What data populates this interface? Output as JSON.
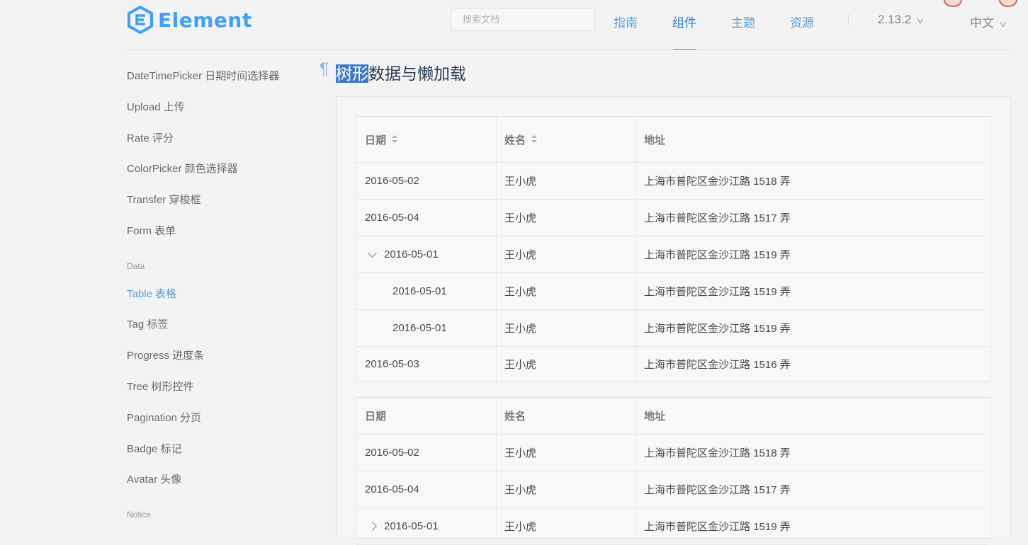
{
  "header": {
    "logo_text": "Element",
    "search_placeholder": "搜索文档",
    "nav": [
      "指南",
      "组件",
      "主题",
      "资源"
    ],
    "active_nav": "组件",
    "version": "2.13.2",
    "language": "中文"
  },
  "sidebar": {
    "items_top": [
      "DateTimePicker 日期时间选择器",
      "Upload 上传",
      "Rate 评分",
      "ColorPicker 颜色选择器",
      "Transfer 穿梭框",
      "Form 表单"
    ],
    "group_data": "Data",
    "items_data": [
      "Table 表格",
      "Tag 标签",
      "Progress 进度条",
      "Tree 树形控件",
      "Pagination 分页",
      "Badge 标记",
      "Avatar 头像"
    ],
    "active_item": "Table 表格",
    "group_notice": "Notice"
  },
  "section": {
    "anchor": "¶",
    "title_highlight": "树形",
    "title_rest": "数据与懒加载"
  },
  "table1": {
    "headers": [
      "日期",
      "姓名",
      "地址"
    ],
    "rows": [
      {
        "date": "2016-05-02",
        "name": "王小虎",
        "address": "上海市普陀区金沙江路 1518 弄"
      },
      {
        "date": "2016-05-04",
        "name": "王小虎",
        "address": "上海市普陀区金沙江路 1517 弄"
      },
      {
        "date": "2016-05-01",
        "name": "王小虎",
        "address": "上海市普陀区金沙江路 1519 弄"
      },
      {
        "date": "2016-05-01",
        "name": "王小虎",
        "address": "上海市普陀区金沙江路 1519 弄"
      },
      {
        "date": "2016-05-01",
        "name": "王小虎",
        "address": "上海市普陀区金沙江路 1519 弄"
      },
      {
        "date": "2016-05-03",
        "name": "王小虎",
        "address": "上海市普陀区金沙江路 1516 弄"
      }
    ]
  },
  "table2": {
    "headers": [
      "日期",
      "姓名",
      "地址"
    ],
    "rows": [
      {
        "date": "2016-05-02",
        "name": "王小虎",
        "address": "上海市普陀区金沙江路 1518 弄"
      },
      {
        "date": "2016-05-04",
        "name": "王小虎",
        "address": "上海市普陀区金沙江路 1517 弄"
      },
      {
        "date": "2016-05-01",
        "name": "王小虎",
        "address": "上海市普陀区金沙江路 1519 弄"
      }
    ]
  }
}
